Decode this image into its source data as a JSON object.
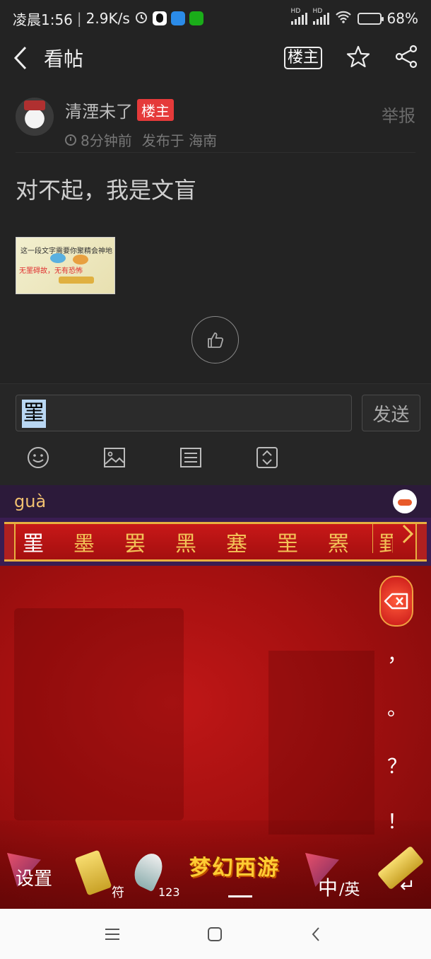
{
  "status_bar": {
    "time": "凌晨1:56",
    "speed": "2.9K/s",
    "battery": "68%",
    "battery_level": 0.68,
    "apps": [
      "alarm-icon",
      "qq-icon",
      "tinder-icon",
      "wechat-icon"
    ]
  },
  "header": {
    "title": "看帖",
    "louzhu_button": "楼主"
  },
  "post": {
    "author": "清湮未了",
    "author_badge": "楼主",
    "time": "8分钟前",
    "location": "发布于 海南",
    "report": "举报",
    "content": "对不起，我是文盲",
    "image_line1": "这一段文字需要你聚精会神地",
    "image_line2": "无罣碍故，无有恐怖"
  },
  "composer": {
    "input_value": "罣",
    "send_label": "发送"
  },
  "ime": {
    "pinyin": "guà",
    "candidates": [
      "罣",
      "墨",
      "罢",
      "黑",
      "塞",
      "罜",
      "罴",
      "罫"
    ],
    "punctuation": [
      "，",
      "。",
      "？",
      "！"
    ],
    "settings_label": "设置",
    "symbol_label": "符",
    "number_label": "123",
    "logo": "梦幻西游",
    "lang_label_zh": "中",
    "lang_label_en": "/英",
    "enter_symbol": "↵"
  },
  "colors": {
    "badge": "#e53a3a",
    "keyboard_red": "#c01717",
    "candidate_gold": "#f3c257"
  }
}
